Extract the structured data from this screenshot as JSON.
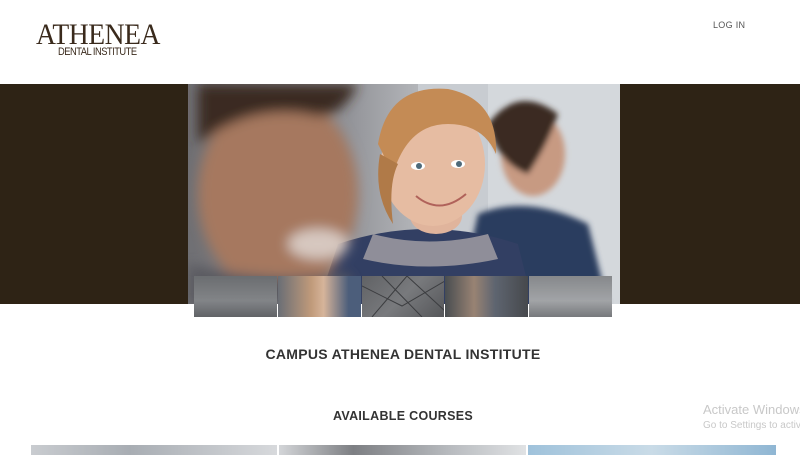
{
  "header": {
    "logo_big": "ATHENEA",
    "logo_small": "DENTAL INSTITUTE",
    "login_label": "LOG IN"
  },
  "hero": {
    "thumbnails": [
      {
        "name": "slide-1"
      },
      {
        "name": "slide-2",
        "active": true
      },
      {
        "name": "slide-3"
      },
      {
        "name": "slide-4"
      },
      {
        "name": "slide-5"
      }
    ]
  },
  "main": {
    "campus_title": "CAMPUS ATHENEA DENTAL INSTITUTE",
    "courses_title": "AVAILABLE COURSES"
  },
  "watermark": {
    "line1": "Activate Windows",
    "line2": "Go to Settings to activate Windows."
  },
  "colors": {
    "hero_band": "#2e2315",
    "logo": "#3a2a1c",
    "heading": "#333333"
  }
}
